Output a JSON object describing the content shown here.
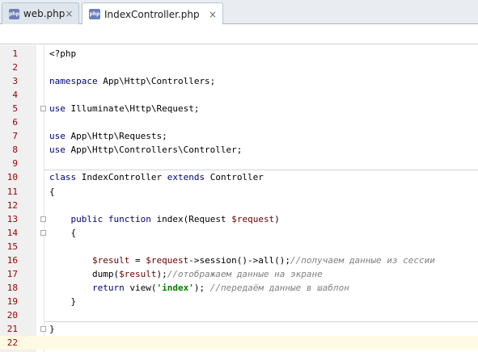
{
  "tabs": [
    {
      "icon": "php-file-icon",
      "icon_text": "php",
      "label": "web.php",
      "close": "×",
      "active": false
    },
    {
      "icon": "php-file-icon",
      "icon_text": "php",
      "label": "IndexController.php",
      "close": "×",
      "active": true
    }
  ],
  "editor": {
    "current_line": 22,
    "lines": [
      {
        "n": "1",
        "tokens": [
          {
            "t": "<?php",
            "c": ""
          }
        ]
      },
      {
        "n": "2",
        "tokens": []
      },
      {
        "n": "3",
        "tokens": [
          {
            "t": "namespace",
            "c": "kw"
          },
          {
            "t": " App\\Http\\Controllers;",
            "c": ""
          }
        ]
      },
      {
        "n": "4",
        "tokens": []
      },
      {
        "n": "5",
        "tokens": [
          {
            "t": "use",
            "c": "kw"
          },
          {
            "t": " Illuminate\\Http\\Request;",
            "c": ""
          }
        ]
      },
      {
        "n": "6",
        "tokens": []
      },
      {
        "n": "7",
        "tokens": [
          {
            "t": "use",
            "c": "kw"
          },
          {
            "t": " App\\Http\\Requests;",
            "c": ""
          }
        ]
      },
      {
        "n": "8",
        "tokens": [
          {
            "t": "use",
            "c": "kw"
          },
          {
            "t": " App\\Http\\Controllers\\Controller;",
            "c": ""
          }
        ]
      },
      {
        "n": "9",
        "tokens": []
      },
      {
        "n": "10",
        "tokens": [
          {
            "t": "class",
            "c": "kw"
          },
          {
            "t": " IndexController ",
            "c": ""
          },
          {
            "t": "extends",
            "c": "kw"
          },
          {
            "t": " Controller",
            "c": ""
          }
        ]
      },
      {
        "n": "11",
        "tokens": [
          {
            "t": "{",
            "c": ""
          }
        ]
      },
      {
        "n": "12",
        "tokens": []
      },
      {
        "n": "13",
        "tokens": [
          {
            "t": "    ",
            "c": ""
          },
          {
            "t": "public",
            "c": "kw"
          },
          {
            "t": " ",
            "c": ""
          },
          {
            "t": "function",
            "c": "kw"
          },
          {
            "t": " index(Request ",
            "c": ""
          },
          {
            "t": "$request",
            "c": "var"
          },
          {
            "t": ")",
            "c": ""
          }
        ]
      },
      {
        "n": "14",
        "tokens": [
          {
            "t": "    {",
            "c": ""
          }
        ]
      },
      {
        "n": "15",
        "tokens": []
      },
      {
        "n": "16",
        "tokens": [
          {
            "t": "        ",
            "c": ""
          },
          {
            "t": "$result",
            "c": "var"
          },
          {
            "t": " = ",
            "c": ""
          },
          {
            "t": "$request",
            "c": "var"
          },
          {
            "t": "->session()->all();",
            "c": ""
          },
          {
            "t": "//получаем данные из сессии",
            "c": "cmt"
          }
        ]
      },
      {
        "n": "17",
        "tokens": [
          {
            "t": "        dump(",
            "c": ""
          },
          {
            "t": "$result",
            "c": "var"
          },
          {
            "t": ");",
            "c": ""
          },
          {
            "t": "//отображаем данные на экране",
            "c": "cmt"
          }
        ]
      },
      {
        "n": "18",
        "tokens": [
          {
            "t": "        ",
            "c": ""
          },
          {
            "t": "return",
            "c": "kw"
          },
          {
            "t": " view(",
            "c": ""
          },
          {
            "t": "'index'",
            "c": "str"
          },
          {
            "t": "); ",
            "c": ""
          },
          {
            "t": "//передаём данные в шаблон",
            "c": "cmt"
          }
        ]
      },
      {
        "n": "19",
        "tokens": [
          {
            "t": "    }",
            "c": ""
          }
        ]
      },
      {
        "n": "20",
        "tokens": []
      },
      {
        "n": "21",
        "tokens": [
          {
            "t": "}",
            "c": ""
          }
        ]
      },
      {
        "n": "22",
        "tokens": []
      }
    ]
  },
  "colors": {
    "keyword": "#000080",
    "variable": "#660000",
    "string": "#008000",
    "comment": "#808080",
    "line_number": "#990000",
    "current_line_bg": "#fffae3"
  }
}
